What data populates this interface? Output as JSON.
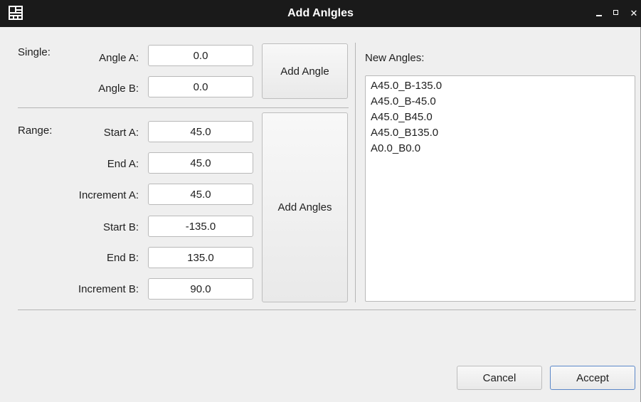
{
  "window": {
    "title": "Add Anlgles",
    "icon": "app-logo-icon"
  },
  "single": {
    "section_label": "Single:",
    "angle_a": {
      "label": "Angle A:",
      "value": "0.0"
    },
    "angle_b": {
      "label": "Angle B:",
      "value": "0.0"
    },
    "add_button": "Add Angle"
  },
  "range": {
    "section_label": "Range:",
    "start_a": {
      "label": "Start A:",
      "value": "45.0"
    },
    "end_a": {
      "label": "End A:",
      "value": "45.0"
    },
    "increment_a": {
      "label": "Increment A:",
      "value": "45.0"
    },
    "start_b": {
      "label": "Start B:",
      "value": "-135.0"
    },
    "end_b": {
      "label": "End B:",
      "value": "135.0"
    },
    "increment_b": {
      "label": "Increment B:",
      "value": "90.0"
    },
    "add_button": "Add Angles"
  },
  "new_angles": {
    "label": "New Angles:",
    "items": [
      "A45.0_B-135.0",
      "A45.0_B-45.0",
      "A45.0_B45.0",
      "A45.0_B135.0",
      "A0.0_B0.0"
    ]
  },
  "footer": {
    "cancel": "Cancel",
    "accept": "Accept"
  },
  "colors": {
    "titlebar": "#1a1a1a",
    "window_bg": "#efefef",
    "accept_border": "#5b87c8"
  }
}
